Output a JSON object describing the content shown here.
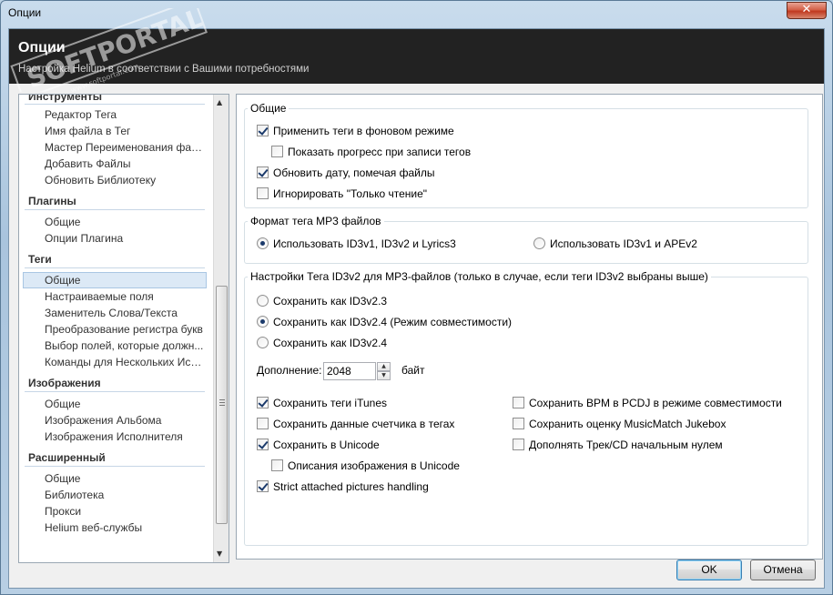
{
  "window": {
    "title": "Опции",
    "close_label": "✕"
  },
  "header": {
    "title": "Опции",
    "subtitle": "Настройка Helium в соответствии с Вашими потребностями",
    "watermark": "SOFTPORTAL",
    "watermark_url": "www.softportal.com"
  },
  "nav": {
    "groups": [
      {
        "label": "Инструменты",
        "items": [
          "Редактор Тега",
          "Имя файла в Тег",
          "Мастер Переименования фай...",
          "Добавить Файлы",
          "Обновить Библиотеку"
        ]
      },
      {
        "label": "Плагины",
        "items": [
          "Общие",
          "Опции Плагина"
        ]
      },
      {
        "label": "Теги",
        "items": [
          "Общие",
          "Настраиваемые поля",
          "Заменитель Слова/Текста",
          "Преобразование регистра букв",
          "Выбор полей, которые должн...",
          "Команды для Нескольких Испо..."
        ]
      },
      {
        "label": "Изображения",
        "items": [
          "Общие",
          "Изображения Альбома",
          "Изображения Исполнителя"
        ]
      },
      {
        "label": "Расширенный",
        "items": [
          "Общие",
          "Библиотека",
          "Прокси",
          "Helium веб-службы"
        ]
      }
    ],
    "selected": "Теги > Общие"
  },
  "general": {
    "legend": "Общие",
    "options": [
      {
        "label": "Применить теги в фоновом режиме",
        "checked": true
      },
      {
        "label": "Показать прогресс при записи тегов",
        "checked": false
      },
      {
        "label": "Обновить дату, помечая файлы",
        "checked": true
      },
      {
        "label": "Игнорировать \"Только чтение\"",
        "checked": false
      }
    ]
  },
  "mp3_format": {
    "legend": "Формат тега MP3 файлов",
    "options": [
      {
        "label": "Использовать ID3v1, ID3v2 и Lyrics3",
        "selected": true
      },
      {
        "label": "Использовать ID3v1 и APEv2",
        "selected": false
      }
    ]
  },
  "id3v2": {
    "legend": "Настройки Тега ID3v2 для MP3-файлов (только в случае, если теги ID3v2 выбраны выше)",
    "versions": [
      {
        "label": "Сохранить как ID3v2.3",
        "selected": false
      },
      {
        "label": "Сохранить как ID3v2.4 (Режим совместимости)",
        "selected": true
      },
      {
        "label": "Сохранить как ID3v2.4",
        "selected": false
      }
    ],
    "padding_label": "Дополнение:",
    "padding_value": "2048",
    "padding_unit": "байт",
    "left_options": [
      {
        "label": "Сохранить теги iTunes",
        "checked": true
      },
      {
        "label": "Сохранить данные счетчика в тегах",
        "checked": false
      },
      {
        "label": "Сохранить в Unicode",
        "checked": true
      },
      {
        "label": "Описания изображения в Unicode",
        "checked": false
      },
      {
        "label": "Strict attached pictures handling",
        "checked": true
      }
    ],
    "right_options": [
      {
        "label": "Сохранить BPM в PCDJ в режиме совместимости",
        "checked": false
      },
      {
        "label": "Сохранить оценку MusicMatch Jukebox",
        "checked": false
      },
      {
        "label": "Дополнять Трек/CD начальным нулем",
        "checked": false
      }
    ]
  },
  "buttons": {
    "ok": "OK",
    "cancel": "Отмена"
  },
  "colors": {
    "header_bg": "#222222",
    "selection": "#dce9f6",
    "frame": "#a9c4dd"
  }
}
